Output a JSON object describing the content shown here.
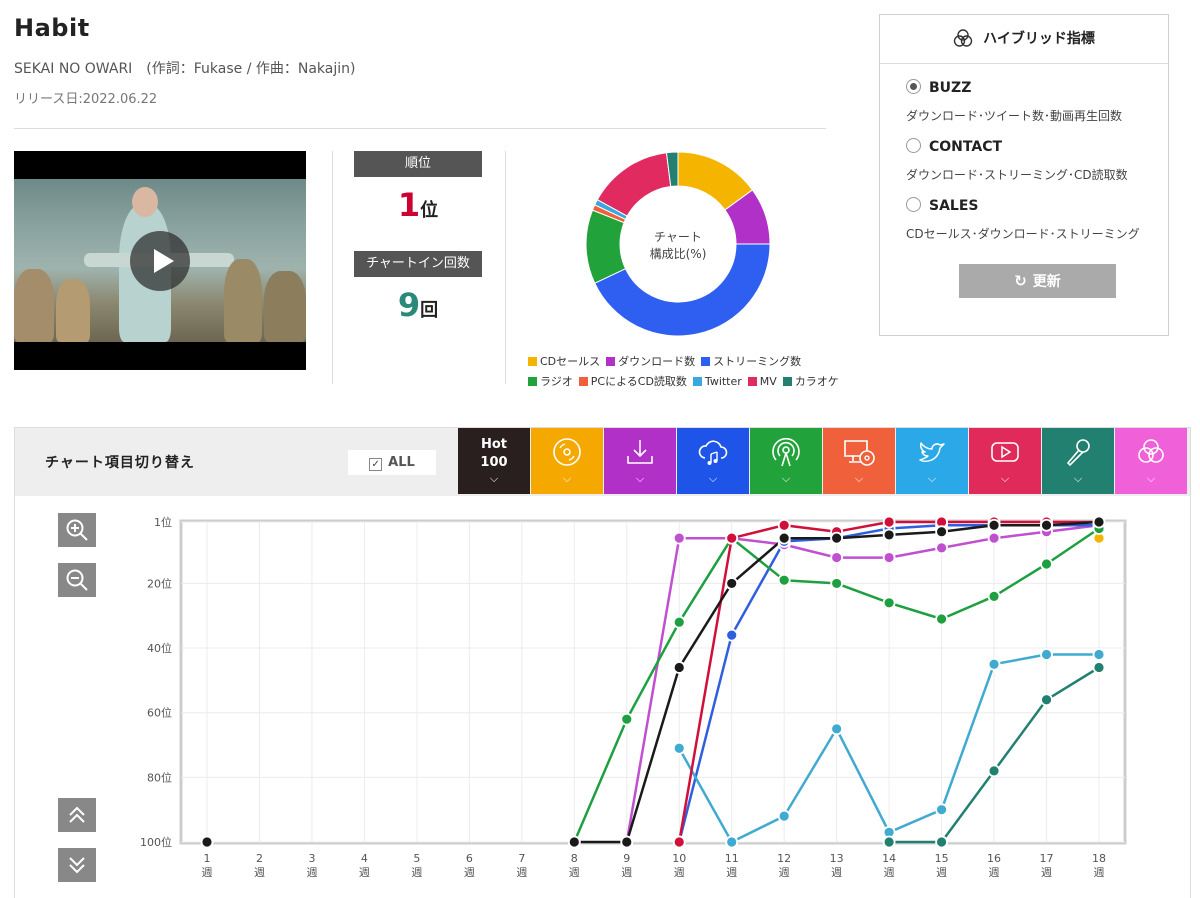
{
  "song": {
    "title": "Habit",
    "artist_line": "SEKAI NO OWARI　(作詞：Fukase / 作曲：Nakajin)",
    "release": "リリース日:2022.06.22"
  },
  "ranking": {
    "rank_label": "順位",
    "rank_value": "1",
    "rank_unit": "位",
    "chartin_label": "チャートイン回数",
    "chartin_value": "9",
    "chartin_unit": "回",
    "rank_color": "#cc0033",
    "chartin_color": "#2a8a7a"
  },
  "donut": {
    "center_line1": "チャート",
    "center_line2": "構成比(%)",
    "slices": [
      {
        "name": "CDセールス",
        "value": 15,
        "color": "#f5b400"
      },
      {
        "name": "ダウンロード数",
        "value": 10,
        "color": "#b030c8"
      },
      {
        "name": "ストリーミング数",
        "value": 43,
        "color": "#2f5ff0"
      },
      {
        "name": "ラジオ",
        "value": 13,
        "color": "#22a23a"
      },
      {
        "name": "PCによるCD読取数",
        "value": 1,
        "color": "#f0603a"
      },
      {
        "name": "Twitter",
        "value": 1,
        "color": "#3aa8e0"
      },
      {
        "name": "MV",
        "value": 15,
        "color": "#e02a60"
      },
      {
        "name": "カラオケ",
        "value": 2,
        "color": "#228070"
      }
    ]
  },
  "hybrid": {
    "title": "ハイブリッド指標",
    "options": [
      {
        "label": "BUZZ",
        "desc": "ダウンロード･ツイート数･動画再生回数",
        "selected": true
      },
      {
        "label": "CONTACT",
        "desc": "ダウンロード･ストリーミング･CD読取数",
        "selected": false
      },
      {
        "label": "SALES",
        "desc": "CDセールス･ダウンロード･ストリーミング",
        "selected": false
      }
    ],
    "update_label": "更新"
  },
  "toolbar": {
    "switch_label": "チャート項目切り替え",
    "all_label": "ALL",
    "hot_line1": "Hot",
    "hot_line2": "100",
    "tabs": [
      {
        "icon": "hot100",
        "color": "#2a1f1f"
      },
      {
        "icon": "cd-icon",
        "color": "#f5a800"
      },
      {
        "icon": "download-icon",
        "color": "#b030c8"
      },
      {
        "icon": "streaming-cloud-icon",
        "color": "#1e55e8"
      },
      {
        "icon": "radio-antenna-icon",
        "color": "#22a23a"
      },
      {
        "icon": "pc-cd-icon",
        "color": "#f0603a"
      },
      {
        "icon": "twitter-bird-icon",
        "color": "#2aa8e8"
      },
      {
        "icon": "youtube-icon",
        "color": "#e02a5a"
      },
      {
        "icon": "microphone-icon",
        "color": "#228070"
      },
      {
        "icon": "venn-icon",
        "color": "#f060d8"
      }
    ]
  },
  "chart_data": {
    "type": "line",
    "x": [
      "1",
      "2",
      "3",
      "4",
      "5",
      "6",
      "7",
      "8",
      "9",
      "10",
      "11",
      "12",
      "13",
      "14",
      "15",
      "16",
      "17",
      "18"
    ],
    "x_unit": "週",
    "y_ticks": [
      "1位",
      "20位",
      "40位",
      "60位",
      "80位",
      "100位"
    ],
    "y_tick_values": [
      1,
      20,
      40,
      60,
      80,
      100
    ],
    "ylim": [
      1,
      100
    ],
    "y_inverted": true,
    "grid": true,
    "series": [
      {
        "key": "cd",
        "color": "#f5b400",
        "values": [
          null,
          null,
          null,
          null,
          null,
          null,
          null,
          null,
          null,
          null,
          null,
          null,
          null,
          null,
          null,
          null,
          null,
          6
        ]
      },
      {
        "key": "download",
        "color": "#c050d0",
        "values": [
          null,
          null,
          null,
          null,
          null,
          null,
          null,
          null,
          100,
          6,
          6,
          8,
          12,
          12,
          9,
          6,
          4,
          2
        ]
      },
      {
        "key": "streaming",
        "color": "#2f5fe0",
        "values": [
          null,
          null,
          null,
          null,
          null,
          null,
          null,
          null,
          null,
          100,
          36,
          7,
          6,
          3,
          2,
          2,
          2,
          2
        ]
      },
      {
        "key": "radio",
        "color": "#1ea040",
        "values": [
          null,
          null,
          null,
          null,
          null,
          null,
          null,
          100,
          62,
          32,
          6,
          19,
          20,
          26,
          31,
          24,
          14,
          3
        ]
      },
      {
        "key": "twitter",
        "color": "#40aad0",
        "values": [
          null,
          null,
          null,
          null,
          null,
          null,
          null,
          null,
          null,
          71,
          100,
          92,
          65,
          97,
          90,
          45,
          42,
          42
        ]
      },
      {
        "key": "mv",
        "color": "#d0103a",
        "values": [
          null,
          null,
          null,
          null,
          null,
          null,
          null,
          null,
          null,
          100,
          6,
          2,
          4,
          1,
          1,
          1,
          1,
          1
        ]
      },
      {
        "key": "karaoke",
        "color": "#228070",
        "values": [
          null,
          null,
          null,
          null,
          null,
          null,
          null,
          null,
          null,
          null,
          null,
          null,
          null,
          100,
          100,
          78,
          56,
          46
        ]
      },
      {
        "key": "hot100",
        "color": "#1a1a1a",
        "values": [
          100,
          null,
          null,
          null,
          null,
          null,
          null,
          100,
          100,
          46,
          20,
          6,
          6,
          5,
          4,
          2,
          2,
          1
        ]
      }
    ]
  }
}
